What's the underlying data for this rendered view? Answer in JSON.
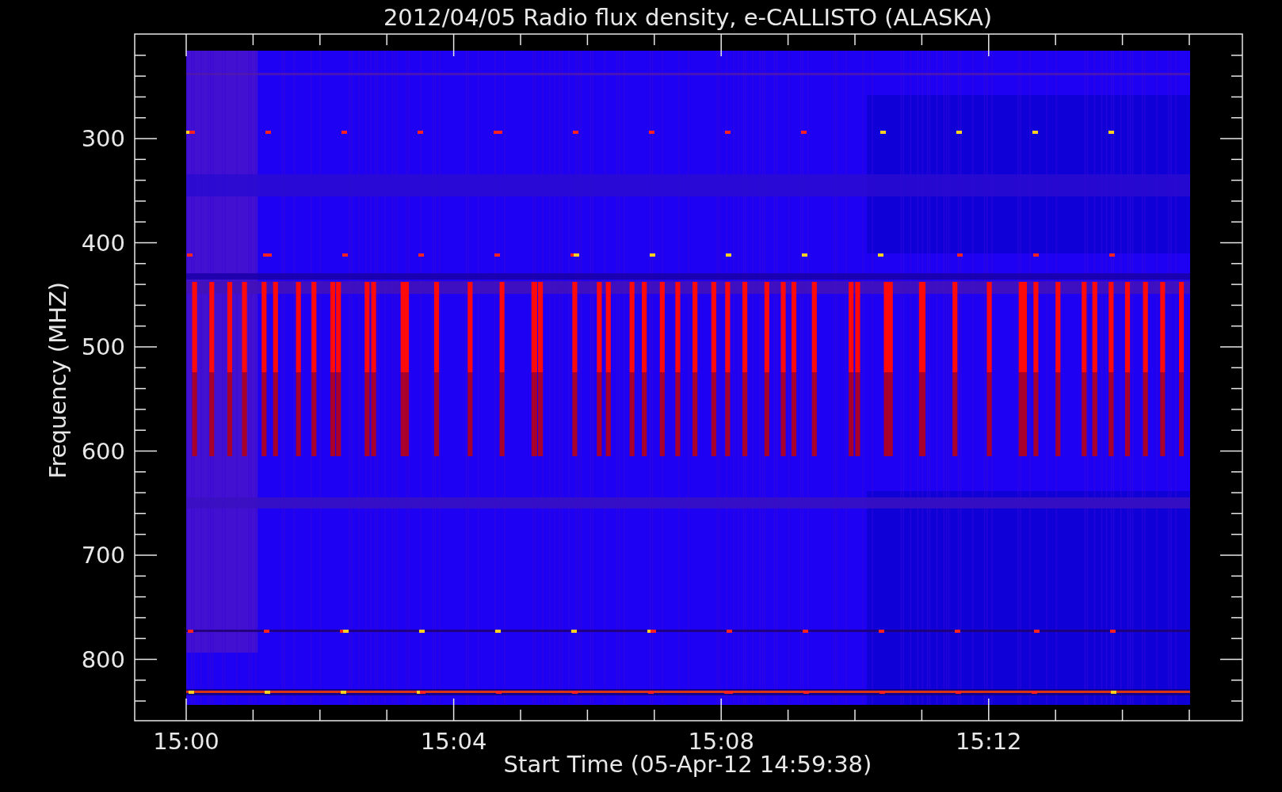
{
  "plot": {
    "title": "2012/04/05  Radio flux density, e-CALLISTO (ALASKA)",
    "y_axis": {
      "label": "Frequency (MHZ)",
      "ticks": [
        "300",
        "400",
        "500",
        "600",
        "700",
        "800"
      ]
    },
    "x_axis": {
      "label": "Start Time (05-Apr-12 14:59:38)",
      "ticks": [
        "15:00",
        "15:04",
        "15:08",
        "15:12"
      ]
    }
  }
}
